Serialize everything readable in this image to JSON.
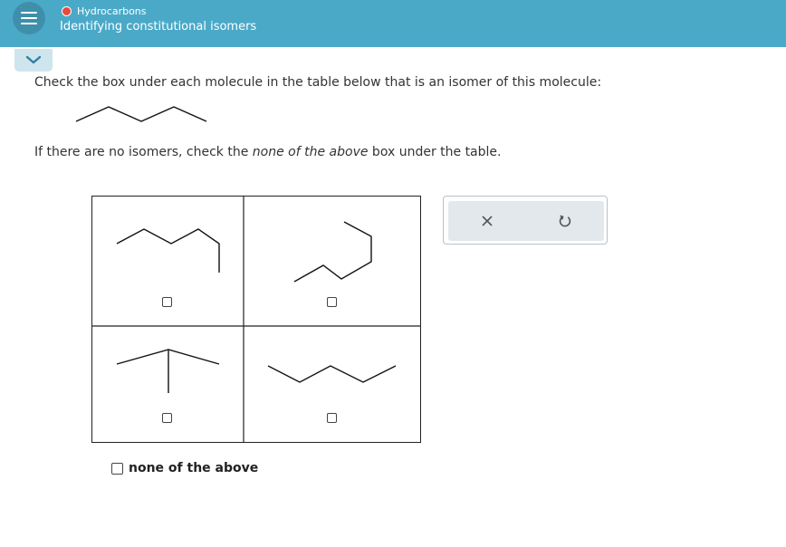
{
  "header": {
    "topic": "Hydrocarbons",
    "title": "Identifying constitutional isomers",
    "colors": {
      "bar": "#4ba9c8",
      "status_dot": "#e8493a"
    },
    "menu_icon": "hamburger-menu-icon",
    "expand_icon": "chevron-down-icon"
  },
  "question": {
    "instruction": "Check the box under each molecule in the table below that is an isomer of this molecule:",
    "note_prefix": "If there are no isomers, check the ",
    "note_emphasis": "none of the above",
    "note_suffix": " box under the table."
  },
  "options": [
    {
      "id": "molecule-1",
      "checked": false
    },
    {
      "id": "molecule-2",
      "checked": false
    },
    {
      "id": "molecule-3",
      "checked": false
    },
    {
      "id": "molecule-4",
      "checked": false
    }
  ],
  "none_option": {
    "label": "none of the above",
    "checked": false
  },
  "tools": {
    "clear_icon": "close-icon",
    "undo_icon": "undo-icon"
  }
}
